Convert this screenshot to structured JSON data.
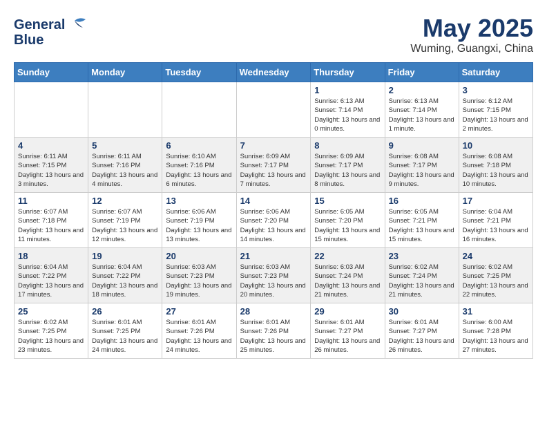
{
  "header": {
    "logo_line1": "General",
    "logo_line2": "Blue",
    "month": "May 2025",
    "location": "Wuming, Guangxi, China"
  },
  "weekdays": [
    "Sunday",
    "Monday",
    "Tuesday",
    "Wednesday",
    "Thursday",
    "Friday",
    "Saturday"
  ],
  "weeks": [
    [
      {
        "day": "",
        "info": ""
      },
      {
        "day": "",
        "info": ""
      },
      {
        "day": "",
        "info": ""
      },
      {
        "day": "",
        "info": ""
      },
      {
        "day": "1",
        "info": "Sunrise: 6:13 AM\nSunset: 7:14 PM\nDaylight: 13 hours and 0 minutes."
      },
      {
        "day": "2",
        "info": "Sunrise: 6:13 AM\nSunset: 7:14 PM\nDaylight: 13 hours and 1 minute."
      },
      {
        "day": "3",
        "info": "Sunrise: 6:12 AM\nSunset: 7:15 PM\nDaylight: 13 hours and 2 minutes."
      }
    ],
    [
      {
        "day": "4",
        "info": "Sunrise: 6:11 AM\nSunset: 7:15 PM\nDaylight: 13 hours and 3 minutes."
      },
      {
        "day": "5",
        "info": "Sunrise: 6:11 AM\nSunset: 7:16 PM\nDaylight: 13 hours and 4 minutes."
      },
      {
        "day": "6",
        "info": "Sunrise: 6:10 AM\nSunset: 7:16 PM\nDaylight: 13 hours and 6 minutes."
      },
      {
        "day": "7",
        "info": "Sunrise: 6:09 AM\nSunset: 7:17 PM\nDaylight: 13 hours and 7 minutes."
      },
      {
        "day": "8",
        "info": "Sunrise: 6:09 AM\nSunset: 7:17 PM\nDaylight: 13 hours and 8 minutes."
      },
      {
        "day": "9",
        "info": "Sunrise: 6:08 AM\nSunset: 7:17 PM\nDaylight: 13 hours and 9 minutes."
      },
      {
        "day": "10",
        "info": "Sunrise: 6:08 AM\nSunset: 7:18 PM\nDaylight: 13 hours and 10 minutes."
      }
    ],
    [
      {
        "day": "11",
        "info": "Sunrise: 6:07 AM\nSunset: 7:18 PM\nDaylight: 13 hours and 11 minutes."
      },
      {
        "day": "12",
        "info": "Sunrise: 6:07 AM\nSunset: 7:19 PM\nDaylight: 13 hours and 12 minutes."
      },
      {
        "day": "13",
        "info": "Sunrise: 6:06 AM\nSunset: 7:19 PM\nDaylight: 13 hours and 13 minutes."
      },
      {
        "day": "14",
        "info": "Sunrise: 6:06 AM\nSunset: 7:20 PM\nDaylight: 13 hours and 14 minutes."
      },
      {
        "day": "15",
        "info": "Sunrise: 6:05 AM\nSunset: 7:20 PM\nDaylight: 13 hours and 15 minutes."
      },
      {
        "day": "16",
        "info": "Sunrise: 6:05 AM\nSunset: 7:21 PM\nDaylight: 13 hours and 15 minutes."
      },
      {
        "day": "17",
        "info": "Sunrise: 6:04 AM\nSunset: 7:21 PM\nDaylight: 13 hours and 16 minutes."
      }
    ],
    [
      {
        "day": "18",
        "info": "Sunrise: 6:04 AM\nSunset: 7:22 PM\nDaylight: 13 hours and 17 minutes."
      },
      {
        "day": "19",
        "info": "Sunrise: 6:04 AM\nSunset: 7:22 PM\nDaylight: 13 hours and 18 minutes."
      },
      {
        "day": "20",
        "info": "Sunrise: 6:03 AM\nSunset: 7:23 PM\nDaylight: 13 hours and 19 minutes."
      },
      {
        "day": "21",
        "info": "Sunrise: 6:03 AM\nSunset: 7:23 PM\nDaylight: 13 hours and 20 minutes."
      },
      {
        "day": "22",
        "info": "Sunrise: 6:03 AM\nSunset: 7:24 PM\nDaylight: 13 hours and 21 minutes."
      },
      {
        "day": "23",
        "info": "Sunrise: 6:02 AM\nSunset: 7:24 PM\nDaylight: 13 hours and 21 minutes."
      },
      {
        "day": "24",
        "info": "Sunrise: 6:02 AM\nSunset: 7:25 PM\nDaylight: 13 hours and 22 minutes."
      }
    ],
    [
      {
        "day": "25",
        "info": "Sunrise: 6:02 AM\nSunset: 7:25 PM\nDaylight: 13 hours and 23 minutes."
      },
      {
        "day": "26",
        "info": "Sunrise: 6:01 AM\nSunset: 7:25 PM\nDaylight: 13 hours and 24 minutes."
      },
      {
        "day": "27",
        "info": "Sunrise: 6:01 AM\nSunset: 7:26 PM\nDaylight: 13 hours and 24 minutes."
      },
      {
        "day": "28",
        "info": "Sunrise: 6:01 AM\nSunset: 7:26 PM\nDaylight: 13 hours and 25 minutes."
      },
      {
        "day": "29",
        "info": "Sunrise: 6:01 AM\nSunset: 7:27 PM\nDaylight: 13 hours and 26 minutes."
      },
      {
        "day": "30",
        "info": "Sunrise: 6:01 AM\nSunset: 7:27 PM\nDaylight: 13 hours and 26 minutes."
      },
      {
        "day": "31",
        "info": "Sunrise: 6:00 AM\nSunset: 7:28 PM\nDaylight: 13 hours and 27 minutes."
      }
    ]
  ]
}
